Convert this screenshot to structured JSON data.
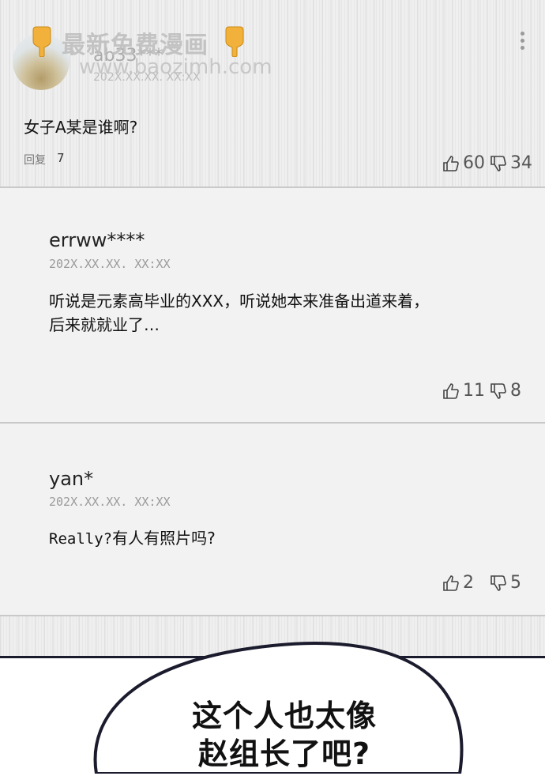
{
  "watermark": {
    "title": "最新免费漫画",
    "url": "www.baozimh.com"
  },
  "comments": [
    {
      "user": "ab33***",
      "date": "202X.XX.XX. XX:XX",
      "text": "女子A某是谁啊?",
      "reply_label": "回复",
      "reply_count": "7",
      "likes": "60",
      "dislikes": "34"
    },
    {
      "user": "errww****",
      "date": "202X.XX.XX. XX:XX",
      "text_line1": "听说是元素高毕业的XXX，听说她本来准备出道来着，",
      "text_line2": "后来就就业了…",
      "likes": "11",
      "dislikes": "8"
    },
    {
      "user": "yan*",
      "date": "202X.XX.XX. XX:XX",
      "text_prefix": "Really?",
      "text_rest": "有人有照片吗?",
      "likes": "2",
      "dislikes": "5"
    }
  ],
  "speech_bubble": {
    "line1": "这个人也太像",
    "line2": "赵组长了吧?"
  },
  "colors": {
    "panel": "#f2f2f2",
    "divider": "#c9c9c9",
    "bubble_outline": "#1b1b2e"
  },
  "icons": [
    "more-vertical-icon",
    "thumbs-up-icon",
    "thumbs-down-icon",
    "pointing-hand-icon"
  ]
}
